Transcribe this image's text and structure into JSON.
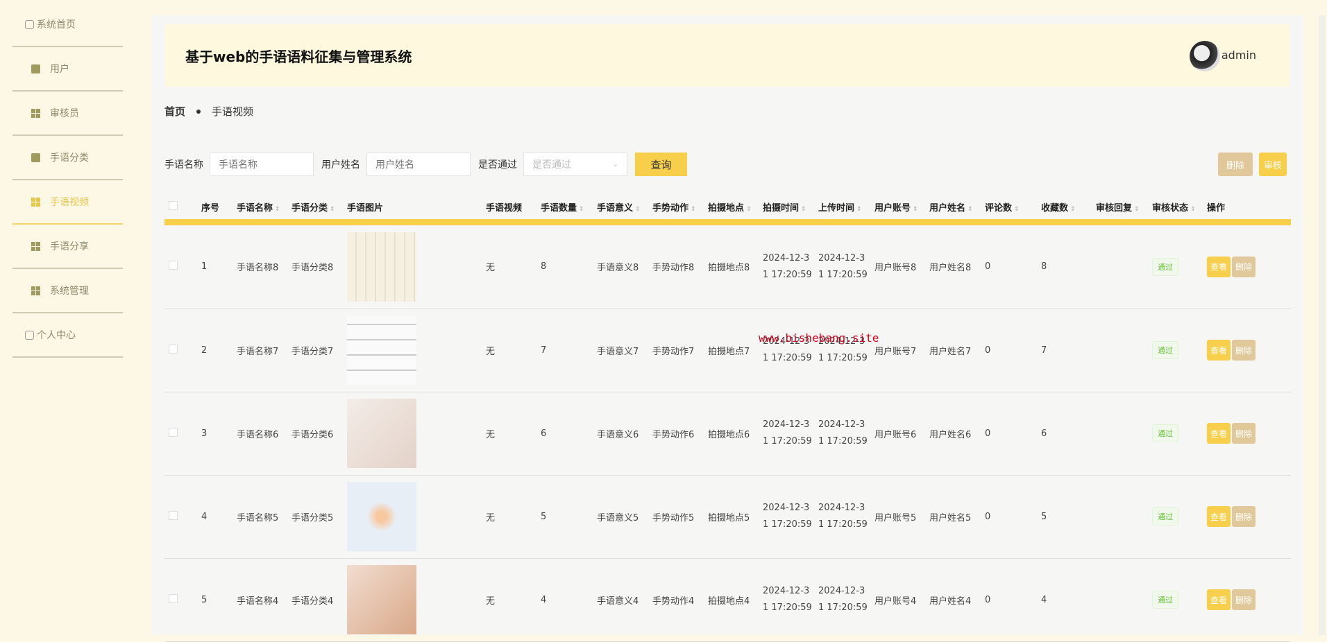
{
  "sidebar": {
    "items": [
      {
        "label": "系统首页",
        "icon": "home-icon"
      },
      {
        "label": "用户",
        "icon": "clipboard-icon"
      },
      {
        "label": "审核员",
        "icon": "grid-icon"
      },
      {
        "label": "手语分类",
        "icon": "briefcase-icon"
      },
      {
        "label": "手语视频",
        "icon": "grid-icon",
        "active": true
      },
      {
        "label": "手语分享",
        "icon": "grid-icon"
      },
      {
        "label": "系统管理",
        "icon": "grid-icon"
      },
      {
        "label": "个人中心",
        "icon": "profile-icon"
      }
    ]
  },
  "header": {
    "title": "基于web的手语语料征集与管理系统",
    "user": "admin"
  },
  "breadcrumb": {
    "home": "首页",
    "current": "手语视频"
  },
  "search": {
    "name_label": "手语名称",
    "name_placeholder": "手语名称",
    "user_label": "用户姓名",
    "user_placeholder": "用户姓名",
    "pass_label": "是否通过",
    "pass_placeholder": "是否通过",
    "query": "查询",
    "delete": "删除",
    "review": "审核"
  },
  "table": {
    "headers": [
      "序号",
      "手语名称",
      "手语分类",
      "手语图片",
      "手语视频",
      "手语数量",
      "手语意义",
      "手势动作",
      "拍摄地点",
      "拍摄时间",
      "上传时间",
      "用户账号",
      "用户姓名",
      "评论数",
      "收藏数",
      "审核回复",
      "审核状态",
      "操作"
    ],
    "rows": [
      {
        "no": "1",
        "name": "手语名称8",
        "cat": "手语分类8",
        "video": "无",
        "count": "8",
        "meaning": "手语意义8",
        "gesture": "手势动作8",
        "place": "拍摄地点8",
        "shoot_a": "2024-12-3",
        "shoot_b": "1 17:20:59",
        "up_a": "2024-12-3",
        "up_b": "1 17:20:59",
        "account": "用户账号8",
        "uname": "用户姓名8",
        "comments": "0",
        "favs": "8",
        "reply": "",
        "status": "通过"
      },
      {
        "no": "2",
        "name": "手语名称7",
        "cat": "手语分类7",
        "video": "无",
        "count": "7",
        "meaning": "手语意义7",
        "gesture": "手势动作7",
        "place": "拍摄地点7",
        "shoot_a": "2024-12-3",
        "shoot_b": "1 17:20:59",
        "up_a": "2024-12-3",
        "up_b": "1 17:20:59",
        "account": "用户账号7",
        "uname": "用户姓名7",
        "comments": "0",
        "favs": "7",
        "reply": "",
        "status": "通过"
      },
      {
        "no": "3",
        "name": "手语名称6",
        "cat": "手语分类6",
        "video": "无",
        "count": "6",
        "meaning": "手语意义6",
        "gesture": "手势动作6",
        "place": "拍摄地点6",
        "shoot_a": "2024-12-3",
        "shoot_b": "1 17:20:59",
        "up_a": "2024-12-3",
        "up_b": "1 17:20:59",
        "account": "用户账号6",
        "uname": "用户姓名6",
        "comments": "0",
        "favs": "6",
        "reply": "",
        "status": "通过"
      },
      {
        "no": "4",
        "name": "手语名称5",
        "cat": "手语分类5",
        "video": "无",
        "count": "5",
        "meaning": "手语意义5",
        "gesture": "手势动作5",
        "place": "拍摄地点5",
        "shoot_a": "2024-12-3",
        "shoot_b": "1 17:20:59",
        "up_a": "2024-12-3",
        "up_b": "1 17:20:59",
        "account": "用户账号5",
        "uname": "用户姓名5",
        "comments": "0",
        "favs": "5",
        "reply": "",
        "status": "通过"
      },
      {
        "no": "5",
        "name": "手语名称4",
        "cat": "手语分类4",
        "video": "无",
        "count": "4",
        "meaning": "手语意义4",
        "gesture": "手势动作4",
        "place": "拍摄地点4",
        "shoot_a": "2024-12-3",
        "shoot_b": "1 17:20:59",
        "up_a": "2024-12-3",
        "up_b": "1 17:20:59",
        "account": "用户账号4",
        "uname": "用户姓名4",
        "comments": "0",
        "favs": "4",
        "reply": "",
        "status": "通过"
      }
    ],
    "view": "查看",
    "delete": "删除"
  },
  "watermark": "www.bishebang.site"
}
